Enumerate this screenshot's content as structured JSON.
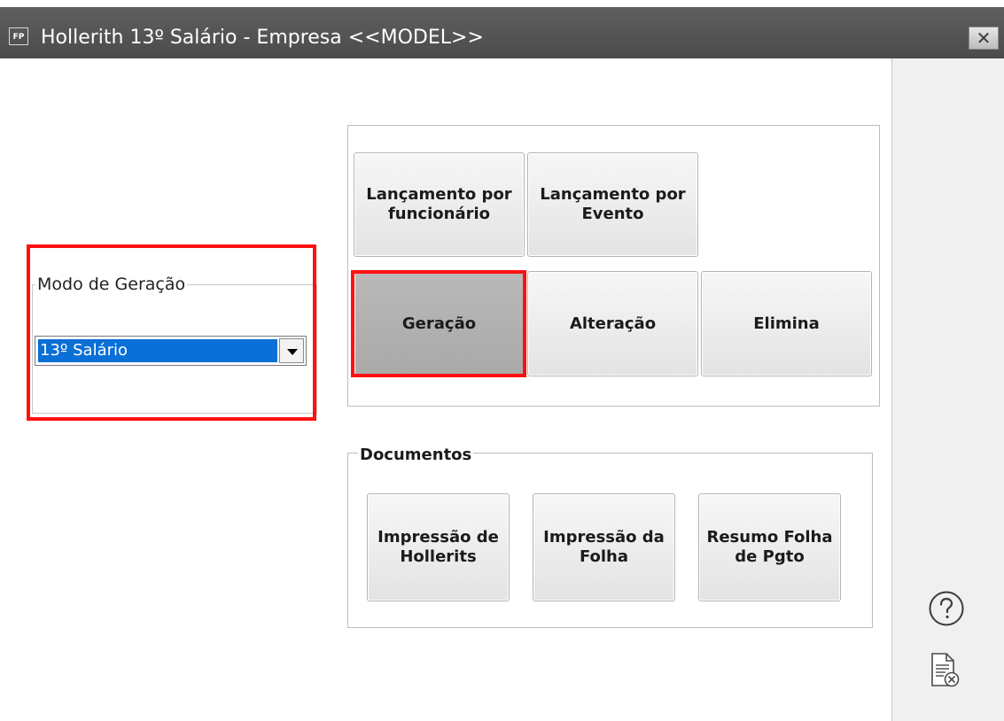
{
  "window": {
    "app_badge": "FP",
    "title": "Hollerith 13º Salário - Empresa <<MODEL>>",
    "close_icon": "close-x-icon"
  },
  "modo_geracao": {
    "group_label": "Modo de Geração",
    "selected_value": "13º Salário"
  },
  "actions": {
    "lancamento_funcionario": "Lançamento por funcionário",
    "lancamento_evento": "Lançamento por Evento",
    "geracao": "Geração",
    "alteracao": "Alteração",
    "elimina": "Elimina"
  },
  "documentos": {
    "group_label": "Documentos",
    "impressao_hollerits": "Impressão de Hollerits",
    "impressao_folha": "Impressão da Folha",
    "resumo_folha": "Resumo Folha de Pgto"
  },
  "side_panel": {
    "help_icon": "help-question-icon",
    "doc_icon": "document-cancel-icon"
  },
  "highlight_color": "#ff1010"
}
